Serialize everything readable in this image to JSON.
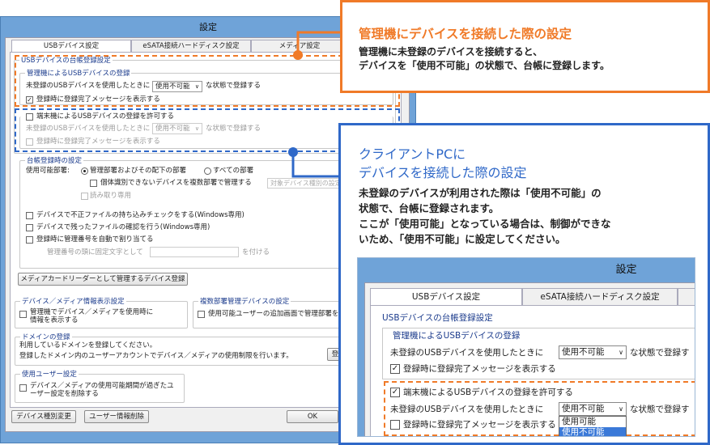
{
  "window": {
    "title": "設定",
    "tabs": [
      "USBデバイス設定",
      "eSATA接続ハードディスク設定",
      "メディア設定"
    ]
  },
  "usb_registry": {
    "legend": "USBデバイスの台帳登録設定",
    "managed": {
      "legend": "管理機によるUSBデバイスの登録",
      "prefix": "未登録のUSBデバイスを使用したときに",
      "select": "使用不可能",
      "suffix": "な状態で登録する",
      "notify_label": "登録時に登録完了メッセージを表示する",
      "notify_checked": "✓"
    },
    "terminal": {
      "allow_label": "端末機によるUSBデバイスの登録を許可する",
      "prefix": "未登録のUSBデバイスを使用したときに",
      "select": "使用不可能",
      "suffix": "な状態で登録する",
      "notify_label": "登録時に登録完了メッセージを表示する"
    }
  },
  "register_time": {
    "legend": "台帳登録時の設定",
    "dept_label": "使用可能部署:",
    "radio1": "管理部署およびその配下の部署",
    "radio2": "すべての部署",
    "multi_dept_label": "個体識別できないデバイスを複数部署で管理する",
    "target_dept": "対象デバイス種別の設定",
    "readonly_label": "読み取り専用",
    "check1": "デバイスで不正ファイルの持ち込みチェックをする(Windows専用)",
    "check2": "デバイスで残ったファイルの確認を行う(Windows専用)",
    "check3": "登録時に管理番号を自動で割り当てる",
    "fixed_text_label": "管理番号の頭に固定文字として",
    "fixed_text_suffix": "を付ける"
  },
  "buttons": {
    "card_reader": "メディアカードリーダーとして管理するデバイス登録",
    "device_change": "デバイス種別変更",
    "user_delete": "ユーザー情報削除",
    "ok": "OK"
  },
  "info_display": {
    "legend": "デバイス／メディア情報表示設定",
    "check": "管理機でデバイス／メディアを使用時に情報を表示する"
  },
  "multi_dept": {
    "legend": "複数部署管理デバイスの設定",
    "check": "使用可能ユーザーの追加画面で管理部署を"
  },
  "domain": {
    "legend": "ドメインの登録",
    "line1": "利用しているドメインを登録してください。",
    "line2": "登録したドメイン内のユーザーアカウントでデバイス／メディアの使用制限を行います。",
    "button": "登"
  },
  "user_settings": {
    "legend": "使用ユーザー設定",
    "check": "デバイス／メディアの使用可能期間が過ぎたユーザー設定を削除する"
  },
  "callout_admin": {
    "title": "管理機にデバイスを接続した際の設定",
    "line1": "管理機に未登録のデバイスを接続すると、",
    "line2": "デバイスを「使用不可能」の状態で、台帳に登録します。"
  },
  "callout_client": {
    "title1": "クライアントPCに",
    "title2": "デバイスを接続した際の設定",
    "line1": "未登録のデバイスが利用された際は「使用不可能」の",
    "line2": "状態で、台帳に登録されます。",
    "line3": "ここが「使用可能」となっている場合は、制御ができな",
    "line4": "いため、「使用不可能」に設定してください。"
  },
  "inset": {
    "title": "設定",
    "tabs": [
      "USBデバイス設定",
      "eSATA接続ハードディスク設定"
    ],
    "registry_legend": "USBデバイスの台帳登録設定",
    "managed_legend": "管理機によるUSBデバイスの登録",
    "prefix": "未登録のUSBデバイスを使用したときに",
    "select": "使用不可能",
    "suffix": "な状態で登録す",
    "notify": "登録時に登録完了メッセージを表示する",
    "notify_checked": "✓",
    "terminal_allow": "端末機によるUSBデバイスの登録を許可する",
    "terminal_checked": "✓",
    "terminal_prefix": "未登録のUSBデバイスを使用したときに",
    "terminal_select": "使用不可能",
    "terminal_suffix": "な状態で登録す",
    "terminal_notify": "登録時に登録完了メッセージを表示する",
    "dropdown_options": [
      "使用可能",
      "使用不可能"
    ]
  },
  "colors": {
    "orange": "#f07a28",
    "blue": "#2f68c8"
  }
}
